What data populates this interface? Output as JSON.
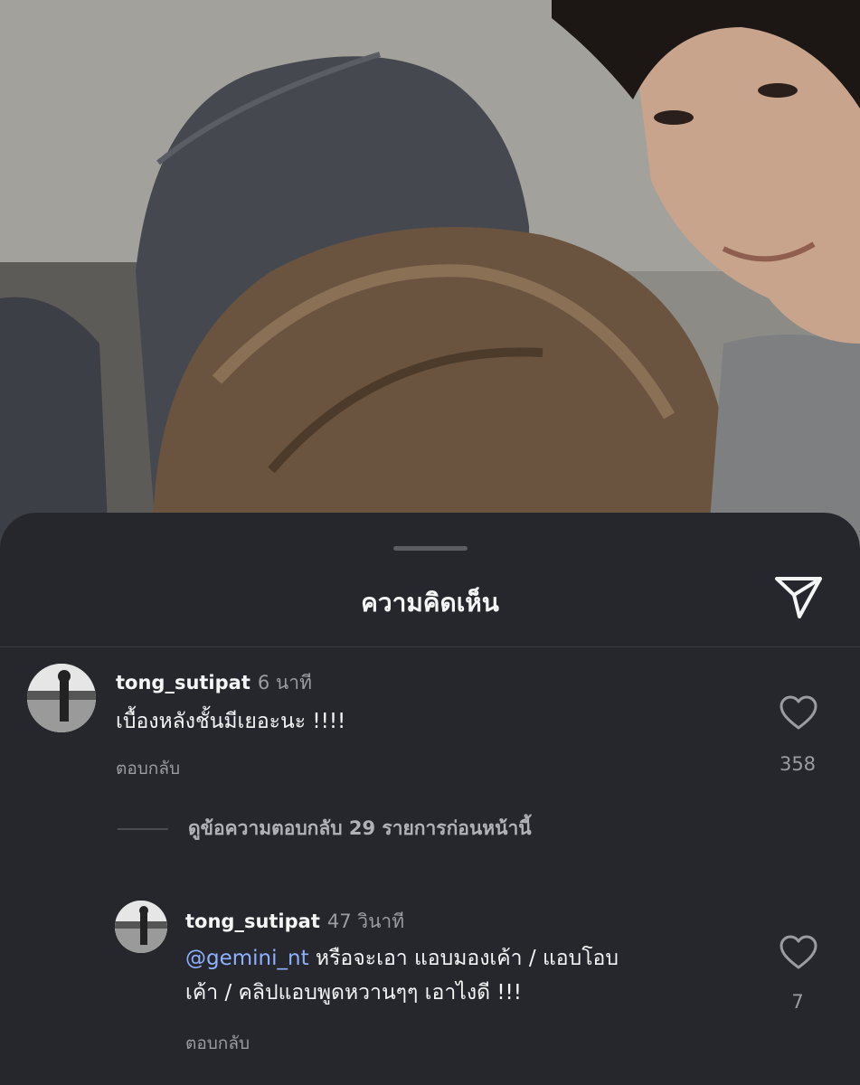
{
  "sheet": {
    "title": "ความคิดเห็น",
    "share_icon": "send-icon"
  },
  "comments": [
    {
      "username": "tong_sutipat",
      "time": "6 นาที",
      "text": "เบื้องหลังชั้นมีเยอะนะ !!!!",
      "reply_label": "ตอบกลับ",
      "like_count": "358"
    }
  ],
  "view_replies": {
    "label": "ดูข้อความตอบกลับ 29 รายการก่อนหน้านี้"
  },
  "replies": [
    {
      "username": "tong_sutipat",
      "time": "47 วินาที",
      "mention": "@gemini_nt",
      "text_line1": " หรือจะเอา แอบมองเค้า / แอบโอบ",
      "text_line2": "เค้า / คลิปแอบพูดหวานๆๆ เอาไงดี !!!",
      "reply_label": "ตอบกลับ",
      "like_count": "7"
    }
  ],
  "colors": {
    "sheet_bg": "#25272d",
    "mention": "#8fb0ff",
    "secondary_text": "#9a9ca2"
  }
}
